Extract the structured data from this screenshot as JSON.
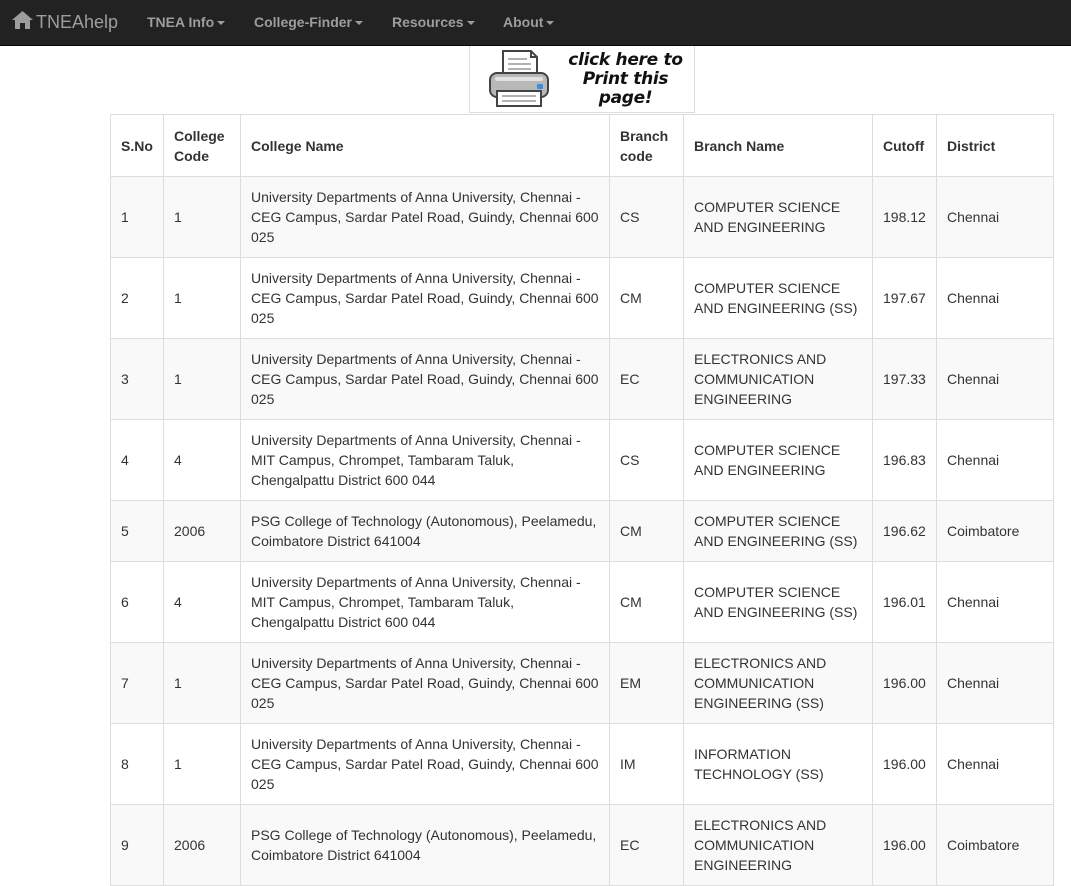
{
  "navbar": {
    "brand": "TNEAhelp",
    "items": [
      {
        "label": "TNEA Info"
      },
      {
        "label": "College-Finder"
      },
      {
        "label": "Resources"
      },
      {
        "label": "About"
      }
    ]
  },
  "print_button": {
    "line1": "click here to",
    "line2": "Print this page!"
  },
  "table": {
    "headers": {
      "sno": "S.No",
      "college_code": "College Code",
      "college_name": "College Name",
      "branch_code": "Branch code",
      "branch_name": "Branch Name",
      "cutoff": "Cutoff",
      "district": "District"
    },
    "rows": [
      {
        "sno": "1",
        "college_code": "1",
        "college_name": "University Departments of Anna University, Chennai - CEG Campus, Sardar Patel Road, Guindy, Chennai 600 025",
        "branch_code": "CS",
        "branch_name": "COMPUTER SCIENCE AND ENGINEERING",
        "cutoff": "198.12",
        "district": "Chennai"
      },
      {
        "sno": "2",
        "college_code": "1",
        "college_name": "University Departments of Anna University, Chennai - CEG Campus, Sardar Patel Road, Guindy, Chennai 600 025",
        "branch_code": "CM",
        "branch_name": "COMPUTER SCIENCE AND ENGINEERING (SS)",
        "cutoff": "197.67",
        "district": "Chennai"
      },
      {
        "sno": "3",
        "college_code": "1",
        "college_name": "University Departments of Anna University, Chennai - CEG Campus, Sardar Patel Road, Guindy, Chennai 600 025",
        "branch_code": "EC",
        "branch_name": "ELECTRONICS AND COMMUNICATION ENGINEERING",
        "cutoff": "197.33",
        "district": "Chennai"
      },
      {
        "sno": "4",
        "college_code": "4",
        "college_name": "University Departments of Anna University, Chennai - MIT Campus, Chrompet, Tambaram Taluk, Chengalpattu District 600 044",
        "branch_code": "CS",
        "branch_name": "COMPUTER SCIENCE AND ENGINEERING",
        "cutoff": "196.83",
        "district": "Chennai"
      },
      {
        "sno": "5",
        "college_code": "2006",
        "college_name": "PSG College of Technology (Autonomous), Peelamedu, Coimbatore District 641004",
        "branch_code": "CM",
        "branch_name": "COMPUTER SCIENCE AND ENGINEERING (SS)",
        "cutoff": "196.62",
        "district": "Coimbatore"
      },
      {
        "sno": "6",
        "college_code": "4",
        "college_name": "University Departments of Anna University, Chennai - MIT Campus, Chrompet, Tambaram Taluk, Chengalpattu District 600 044",
        "branch_code": "CM",
        "branch_name": "COMPUTER SCIENCE AND ENGINEERING (SS)",
        "cutoff": "196.01",
        "district": "Chennai"
      },
      {
        "sno": "7",
        "college_code": "1",
        "college_name": "University Departments of Anna University, Chennai - CEG Campus, Sardar Patel Road, Guindy, Chennai 600 025",
        "branch_code": "EM",
        "branch_name": "ELECTRONICS AND COMMUNICATION ENGINEERING (SS)",
        "cutoff": "196.00",
        "district": "Chennai"
      },
      {
        "sno": "8",
        "college_code": "1",
        "college_name": "University Departments of Anna University, Chennai - CEG Campus, Sardar Patel Road, Guindy, Chennai 600 025",
        "branch_code": "IM",
        "branch_name": "INFORMATION TECHNOLOGY (SS)",
        "cutoff": "196.00",
        "district": "Chennai"
      },
      {
        "sno": "9",
        "college_code": "2006",
        "college_name": "PSG College of Technology (Autonomous), Peelamedu, Coimbatore District 641004",
        "branch_code": "EC",
        "branch_name": "ELECTRONICS AND COMMUNICATION ENGINEERING",
        "cutoff": "196.00",
        "district": "Coimbatore"
      }
    ]
  }
}
